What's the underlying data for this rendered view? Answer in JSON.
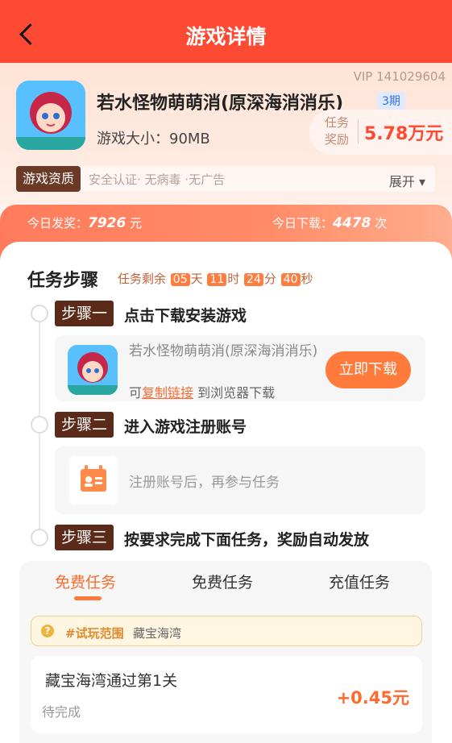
{
  "header": {
    "title": "游戏详情"
  },
  "game": {
    "vip": "VIP 141029604",
    "name": "若水怪物萌萌消(原深海消消乐)",
    "period": "3期",
    "size": "游戏大小：90MB",
    "reward_label": "任务奖励",
    "reward_value": "5.78万元",
    "qualification_tag": "游戏资质",
    "qualification_text": "安全认证· 无病毒 ·无广告",
    "expand": "展开 ▾"
  },
  "stats": {
    "today_payout_label": "今日发奖：",
    "today_payout_value": "7926",
    "today_payout_unit": " 元",
    "today_download_label": "今日下载：",
    "today_download_value": "4478",
    "today_download_unit": " 次"
  },
  "tasks": {
    "title": "任务步骤",
    "countdown_label": "任务剩余",
    "days": "05",
    "days_unit": "天",
    "hours": "11",
    "hours_unit": "时",
    "minutes": "24",
    "minutes_unit": "分",
    "seconds": "40",
    "seconds_unit": "秒"
  },
  "steps": [
    {
      "tag": "步骤一",
      "title": "点击下载安装游戏"
    },
    {
      "tag": "步骤二",
      "title": "进入游戏注册账号"
    },
    {
      "tag": "步骤三",
      "title": "按要求完成下面任务，奖励自动发放"
    }
  ],
  "download_card": {
    "name": "若水怪物萌萌消(原深海消消乐)",
    "sub_prefix": "可",
    "copy_link": "复制链接",
    "sub_suffix": " 到浏览器下载",
    "button": "立即下载"
  },
  "register_card": {
    "text": "注册账号后，再参与任务"
  },
  "panel": {
    "tabs": [
      "免费任务",
      "免费任务",
      "充值任务"
    ],
    "range_label": "#试玩范围",
    "range_value": "藏宝海湾",
    "item": {
      "name": "藏宝海湾通过第1关",
      "status": "待完成",
      "reward": "+0.45元"
    }
  }
}
